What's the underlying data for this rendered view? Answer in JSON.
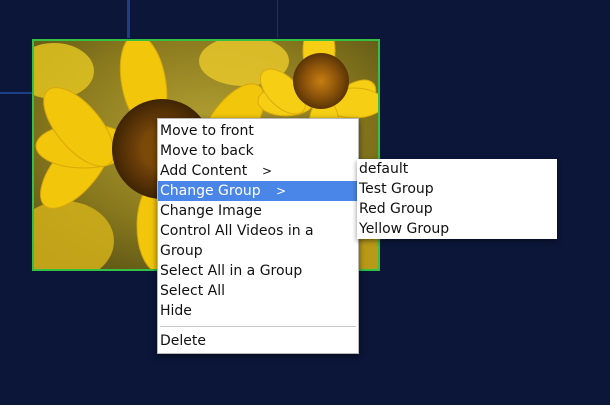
{
  "context_menu": {
    "items": [
      {
        "label": "Move to front"
      },
      {
        "label": "Move to back"
      },
      {
        "label": "Add Content",
        "arrow": ">"
      },
      {
        "label": "Change Group",
        "arrow": ">"
      },
      {
        "label": "Change Image"
      },
      {
        "label": "Control All Videos in a Group"
      },
      {
        "label": "Select All in a Group"
      },
      {
        "label": "Select All"
      },
      {
        "label": "Hide"
      },
      {
        "label": "Delete"
      }
    ]
  },
  "submenu": {
    "items": [
      {
        "label": "default"
      },
      {
        "label": "Test Group"
      },
      {
        "label": "Red Group"
      },
      {
        "label": "Yellow Group"
      }
    ]
  },
  "colors": {
    "background": "#0b1638",
    "selection_border": "#33c043",
    "menu_highlight": "#4a86e8"
  }
}
